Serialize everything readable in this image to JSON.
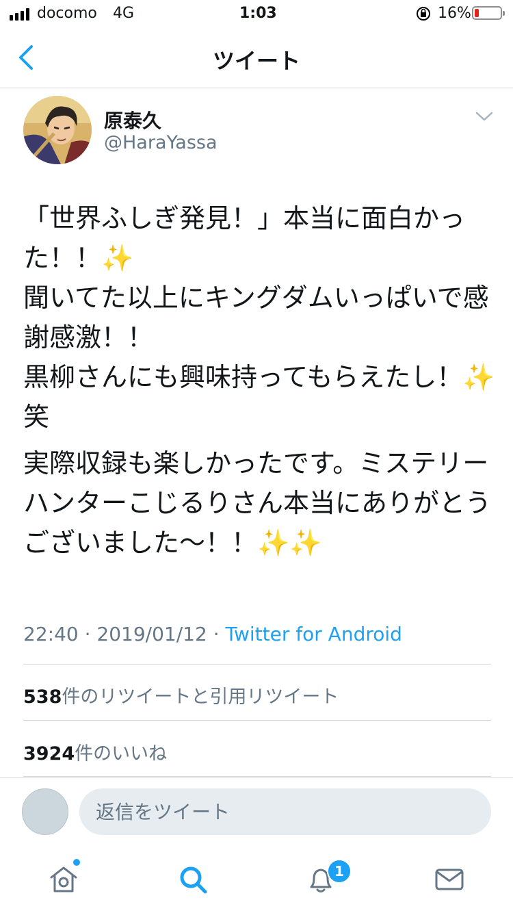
{
  "status_bar": {
    "carrier": "docomo",
    "network": "4G",
    "time": "1:03",
    "battery_percent": "16%",
    "battery_level": 0.16
  },
  "nav": {
    "title": "ツイート",
    "back_icon": "chevron-left-icon"
  },
  "tweet": {
    "display_name": "原泰久",
    "handle": "@HaraYassa",
    "paragraphs": [
      "「世界ふしぎ発見！」本当に面白かった！！✨\n聞いてた以上にキングダムいっぱいで感謝感激！！\n黒柳さんにも興味持ってもらえたし！✨笑",
      "実際収録も楽しかったです。ミステリーハンターこじるりさん本当にありがとうございました〜！！✨✨"
    ],
    "time": "22:40",
    "separator": "·",
    "date": "2019/01/12",
    "source": "Twitter for Android",
    "retweets_count": "538",
    "retweets_label": "件のリツイートと引用リツイート",
    "likes_count": "3924",
    "likes_label": "件のいいね"
  },
  "reply": {
    "placeholder": "返信をツイート"
  },
  "tab_bar": {
    "notification_badge": "1",
    "items": [
      "home-icon",
      "search-icon",
      "notifications-icon",
      "messages-icon"
    ]
  },
  "colors": {
    "accent": "#1da1f2",
    "secondary_text": "#657786",
    "divider": "#d4d8db",
    "battery_low": "#e5231b"
  }
}
